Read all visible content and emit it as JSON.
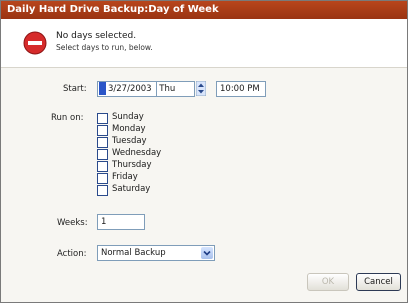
{
  "window": {
    "title": "Daily Hard Drive Backup:Day of Week"
  },
  "message": {
    "headline": "No days selected.",
    "detail": "Select days to run, below."
  },
  "start": {
    "label": "Start:",
    "date_value": "3/27/2003",
    "day_value": "Thu",
    "time_value": "10:00 PM"
  },
  "run_on": {
    "label": "Run on:",
    "days": [
      {
        "label": "Sunday",
        "checked": false
      },
      {
        "label": "Monday",
        "checked": false
      },
      {
        "label": "Tuesday",
        "checked": false
      },
      {
        "label": "Wednesday",
        "checked": false
      },
      {
        "label": "Thursday",
        "checked": false
      },
      {
        "label": "Friday",
        "checked": false
      },
      {
        "label": "Saturday",
        "checked": false
      }
    ]
  },
  "weeks": {
    "label": "Weeks:",
    "value": "1"
  },
  "action": {
    "label": "Action:",
    "value": "Normal Backup"
  },
  "buttons": {
    "ok": "OK",
    "cancel": "Cancel"
  },
  "colors": {
    "title_bar": "#a83c16",
    "stop_icon": "#d62b2b",
    "accent": "#2a55c8"
  }
}
